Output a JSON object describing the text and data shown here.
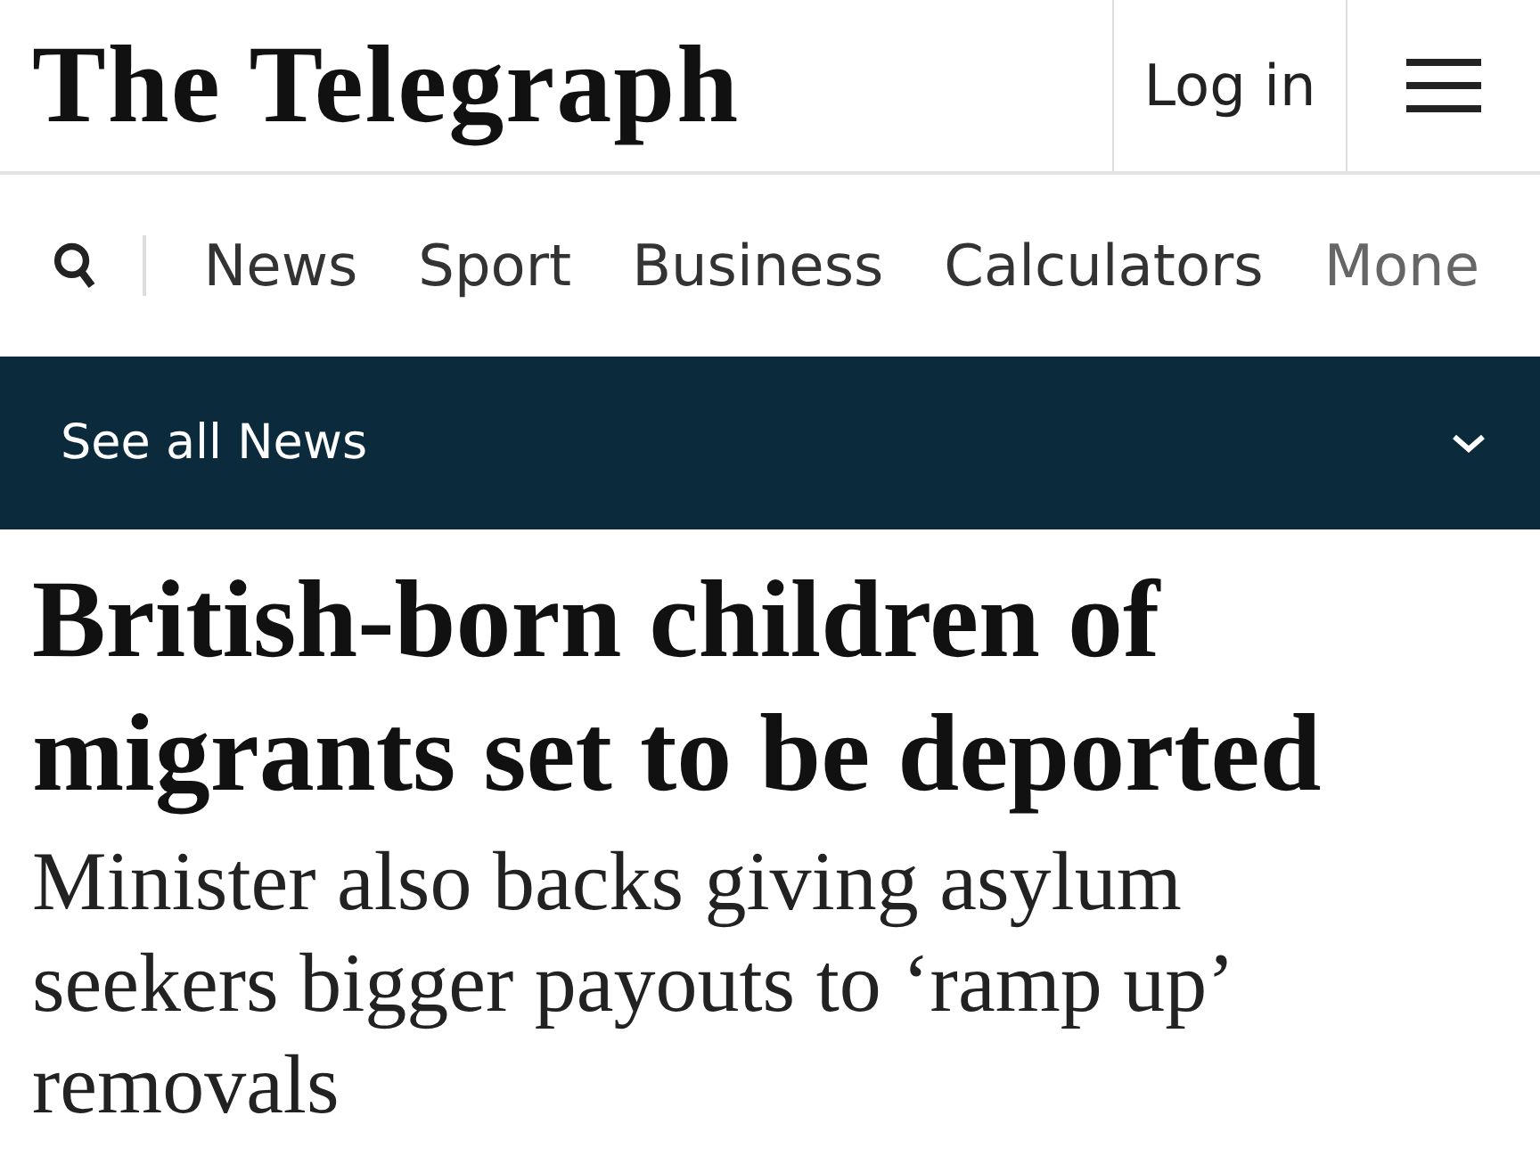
{
  "header": {
    "logo": "The Telegraph",
    "login": "Log in"
  },
  "nav": {
    "items": [
      "News",
      "Sport",
      "Business",
      "Calculators",
      "Mone"
    ]
  },
  "section_bar": {
    "label": "See all News",
    "expanded": false
  },
  "article": {
    "headline": "British-born children of migrants set to be deported",
    "standfirst": "Minister also backs giving asylum seekers bigger payouts to ‘ramp up’ removals"
  }
}
